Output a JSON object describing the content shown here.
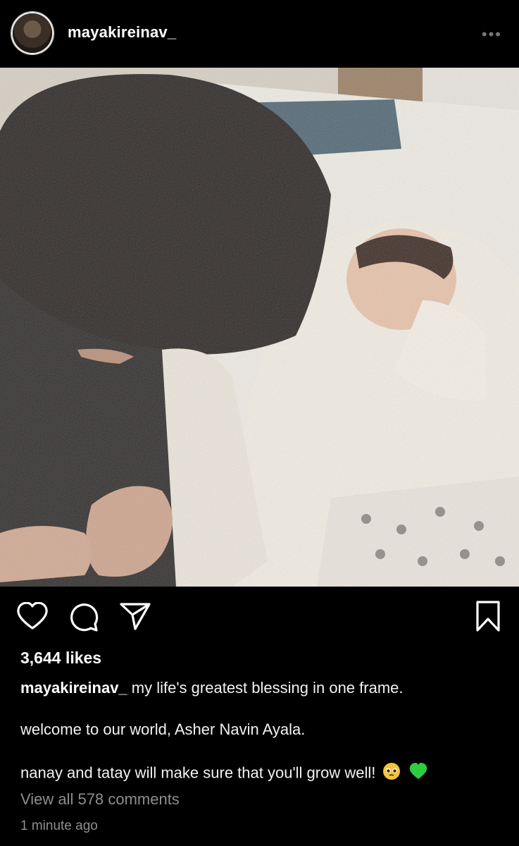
{
  "post": {
    "username": "mayakireinav_",
    "more_label": "•••",
    "likes": "3,644 likes",
    "caption_lines": [
      "my life's greatest blessing in one frame.",
      "welcome to our world, Asher Navin Ayala.",
      "nanay and tatay will make sure that you'll grow well!"
    ],
    "view_comments": "View all 578 comments",
    "timestamp": "1 minute ago"
  },
  "icons": {
    "like": "heart-icon",
    "comment": "comment-icon",
    "share": "paper-plane-icon",
    "save": "bookmark-icon",
    "caption_emojis": [
      "pleading-face-emoji",
      "green-heart-emoji"
    ]
  },
  "colors": {
    "background": "#000000",
    "text": "#ffffff",
    "muted": "#8e8e8e",
    "green_heart": "#2ecc40",
    "pleading_face": "#f6c33c"
  }
}
